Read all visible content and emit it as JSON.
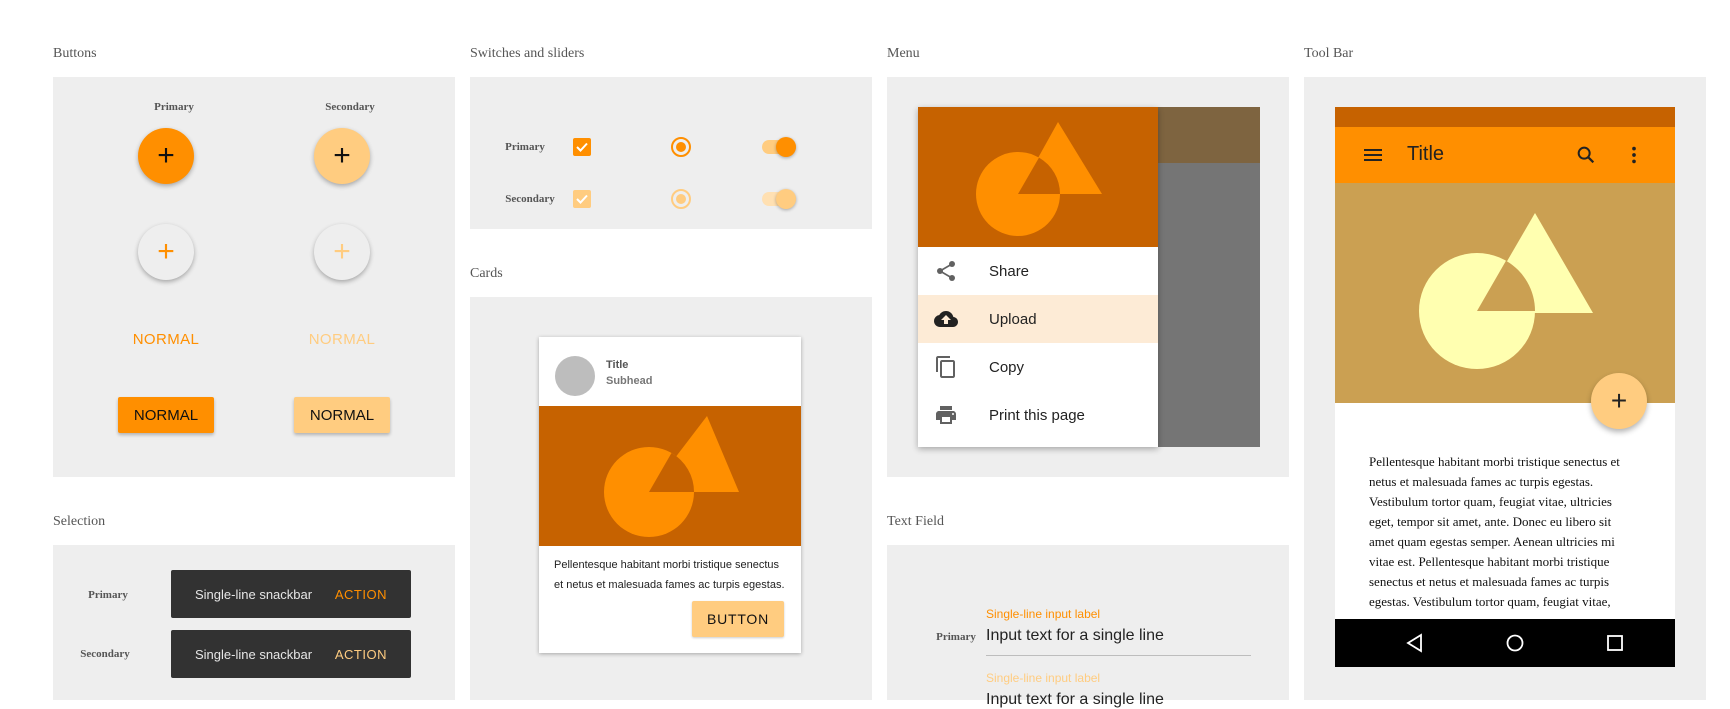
{
  "colors": {
    "primary": "#ff8f00",
    "secondary": "#ffcc80",
    "panel_bg": "#eeeeee",
    "dark_primary": "#c66200",
    "toolbar_image_bg": "#cba052",
    "snackbar_bg": "#323232",
    "nav_bar_bg": "#000000"
  },
  "buttons": {
    "title": "Buttons",
    "primary_label": "Primary",
    "secondary_label": "Secondary",
    "fab_symbol": "+",
    "flat_label": "NORMAL",
    "raised_label": "NORMAL"
  },
  "switches": {
    "title": "Switches and sliders",
    "primary_label": "Primary",
    "secondary_label": "Secondary"
  },
  "menu": {
    "title": "Menu",
    "items": [
      {
        "label": "Share",
        "icon": "share-icon"
      },
      {
        "label": "Upload",
        "icon": "cloud-upload-icon"
      },
      {
        "label": "Copy",
        "icon": "copy-icon"
      },
      {
        "label": "Print this page",
        "icon": "print-icon"
      }
    ]
  },
  "toolbar": {
    "title": "Tool Bar",
    "app_title": "Title",
    "fab_symbol": "+",
    "body_text": "Pellentesque habitant morbi tristique senectus et netus et malesuada fames ac turpis egestas. Vestibulum tortor quam, feugiat vitae, ultricies eget, tempor sit amet, ante. Donec eu libero sit amet quam egestas semper. Aenean ultricies mi vitae est. Pellentesque habitant morbi tristique senectus et netus et malesuada fames ac turpis egestas. Vestibulum tortor quam, feugiat vitae,"
  },
  "cards": {
    "title": "Cards",
    "card_title": "Title",
    "card_subhead": "Subhead",
    "body_text": "Pellentesque habitant morbi tristique senectus et netus et malesuada fames ac turpis egestas.",
    "button_label": "BUTTON"
  },
  "selection": {
    "title": "Selection",
    "primary_label": "Primary",
    "secondary_label": "Secondary",
    "snackbar_message": "Single-line snackbar",
    "snackbar_action": "ACTION"
  },
  "text_field": {
    "title": "Text Field",
    "primary_label": "Primary",
    "input_label": "Single-line input label",
    "input_value": "Input text for a single line"
  }
}
